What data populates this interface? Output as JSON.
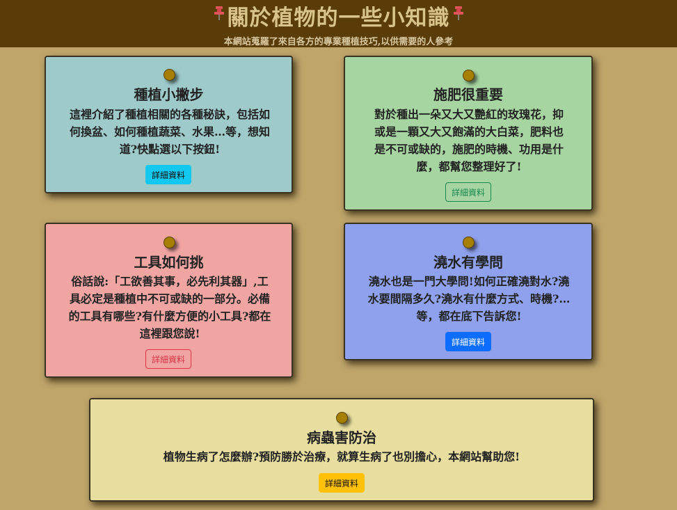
{
  "header": {
    "title": "關於植物的一些小知識",
    "subtitle": "本網站蒐羅了來自各方的專業種植技巧,以供需要的人參考"
  },
  "cards": [
    {
      "title": "種植小撇步",
      "lines": [
        "這裡介紹了種植相關的各種秘訣，包括如",
        "何換盆、如何種植蔬菜、水果…等，想知",
        "道?快點選以下按鈕!"
      ],
      "button": "詳細資料"
    },
    {
      "title": "施肥很重要",
      "lines": [
        "對於種出一朵又大又艷紅的玫瑰花，抑",
        "或是一顆又大又飽滿的大白菜，肥料也",
        "是不可或缺的，施肥的時機、功用是什",
        "麼，都幫您整理好了!"
      ],
      "button": "詳細資料"
    },
    {
      "title": "工具如何挑",
      "lines": [
        "俗話說:「工欲善其事，必先利其器」,工",
        "具必定是種植中不可或缺的一部分。必備",
        "的工具有哪些?有什麼方便的小工具?都在",
        "這裡跟您說!"
      ],
      "button": "詳細資料"
    },
    {
      "title": "澆水有學問",
      "lines": [
        "澆水也是一門大學問!如何正確澆對水?澆",
        "水要間隔多久?澆水有什麼方式、時機?…",
        "等，都在底下告訴您!"
      ],
      "button": "詳細資料"
    },
    {
      "title": "病蟲害防治",
      "lines": [
        "植物生病了怎麼辦?預防勝於治療，就算生病了也別擔心，本網站幫助您!"
      ],
      "button": "詳細資料"
    }
  ],
  "colors": {
    "header_bg": "#5a3c08",
    "page_bg": "#bfa56a",
    "card1": "#9ecaca",
    "card2": "#a7d5a1",
    "card3": "#f0a5a3",
    "card4": "#8fa1ec",
    "card5": "#e7de9f"
  },
  "icons": {
    "title_left": "pushpin-icon",
    "title_right": "pushpin-icon",
    "card_pin": "thumbtack-icon"
  }
}
